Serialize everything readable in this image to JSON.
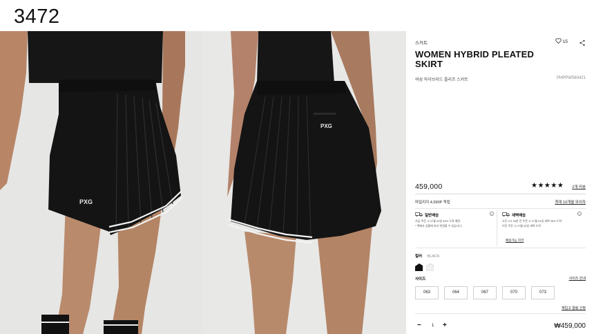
{
  "screenshot_index": "3472",
  "colors": {
    "text": "#111111",
    "border": "#cfcfcf",
    "skirt": "#141414",
    "background": "#ffffff"
  },
  "images": {
    "front": {
      "alt": "WOMEN HYBRID PLEATED SKIRT front view",
      "logo": "PXG"
    },
    "back": {
      "alt": "WOMEN HYBRID PLEATED SKIRT back view",
      "logo": "PXG"
    }
  },
  "product": {
    "category": "스커트",
    "wishlist_count": "15",
    "title": "WOMEN HYBRID PLEATED SKIRT",
    "subtitle": "여성 하이브리드 플리츠 스커트",
    "code": "PHPPW560421",
    "price": "459,000",
    "rating_stars": "★★★★★",
    "reviews_link": "2개 리뷰"
  },
  "mileage": {
    "text": "마일리지 4,590P 적립",
    "link": "최대 10개월 무이자"
  },
  "shipping": {
    "standard": {
      "title": "일반배송",
      "line1": "지금 주문 시 07월 04일 89% 도착 예정",
      "line2": "* 택배사 상황에 따라 변경될 수 있습니다."
    },
    "dawn": {
      "title": "새벽배송",
      "line1": "오후 2시 30분 전 주문 시 07월 04일 새벽 98% 도착",
      "line2": "이후 주문 시 07월 05일 새벽 도착",
      "link": "배송가능 지역"
    }
  },
  "color": {
    "label": "컬러",
    "value": "BLACK"
  },
  "size": {
    "label": "사이즈",
    "guide_link": "사이즈 안내",
    "options": [
      "063",
      "064",
      "067",
      "070",
      "073"
    ],
    "restock_link": "재입고 알림 신청"
  },
  "quantity": {
    "minus": "−",
    "value": "1",
    "plus": "+"
  },
  "total": "₩459,000"
}
